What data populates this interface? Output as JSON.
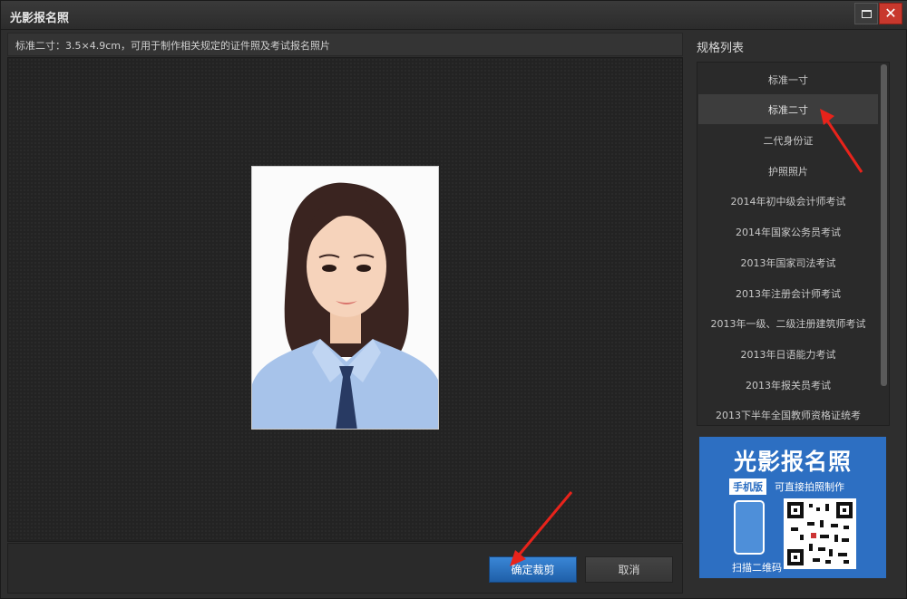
{
  "window": {
    "title": "光影报名照"
  },
  "infobar": {
    "text": "标准二寸：3.5×4.9cm，可用于制作相关规定的证件照及考试报名照片"
  },
  "sidebar": {
    "title": "规格列表",
    "items": [
      {
        "label": "标准一寸"
      },
      {
        "label": "标准二寸"
      },
      {
        "label": "二代身份证"
      },
      {
        "label": "护照照片"
      },
      {
        "label": "2014年初中级会计师考试"
      },
      {
        "label": "2014年国家公务员考试"
      },
      {
        "label": "2013年国家司法考试"
      },
      {
        "label": "2013年注册会计师考试"
      },
      {
        "label": "2013年一级、二级注册建筑师考试"
      },
      {
        "label": "2013年日语能力考试"
      },
      {
        "label": "2013年报关员考试"
      },
      {
        "label": "2013下半年全国教师资格证统考"
      }
    ],
    "selected_index": 1
  },
  "buttons": {
    "confirm": "确定裁剪",
    "cancel": "取消"
  },
  "ad": {
    "title": "光影报名照",
    "tag": "手机版",
    "subtitle": "可直接拍照制作",
    "qr_caption": "扫描二维码"
  },
  "colors": {
    "accent": "#2d6fc2",
    "close": "#c8382d",
    "arrow": "#e8231b"
  }
}
